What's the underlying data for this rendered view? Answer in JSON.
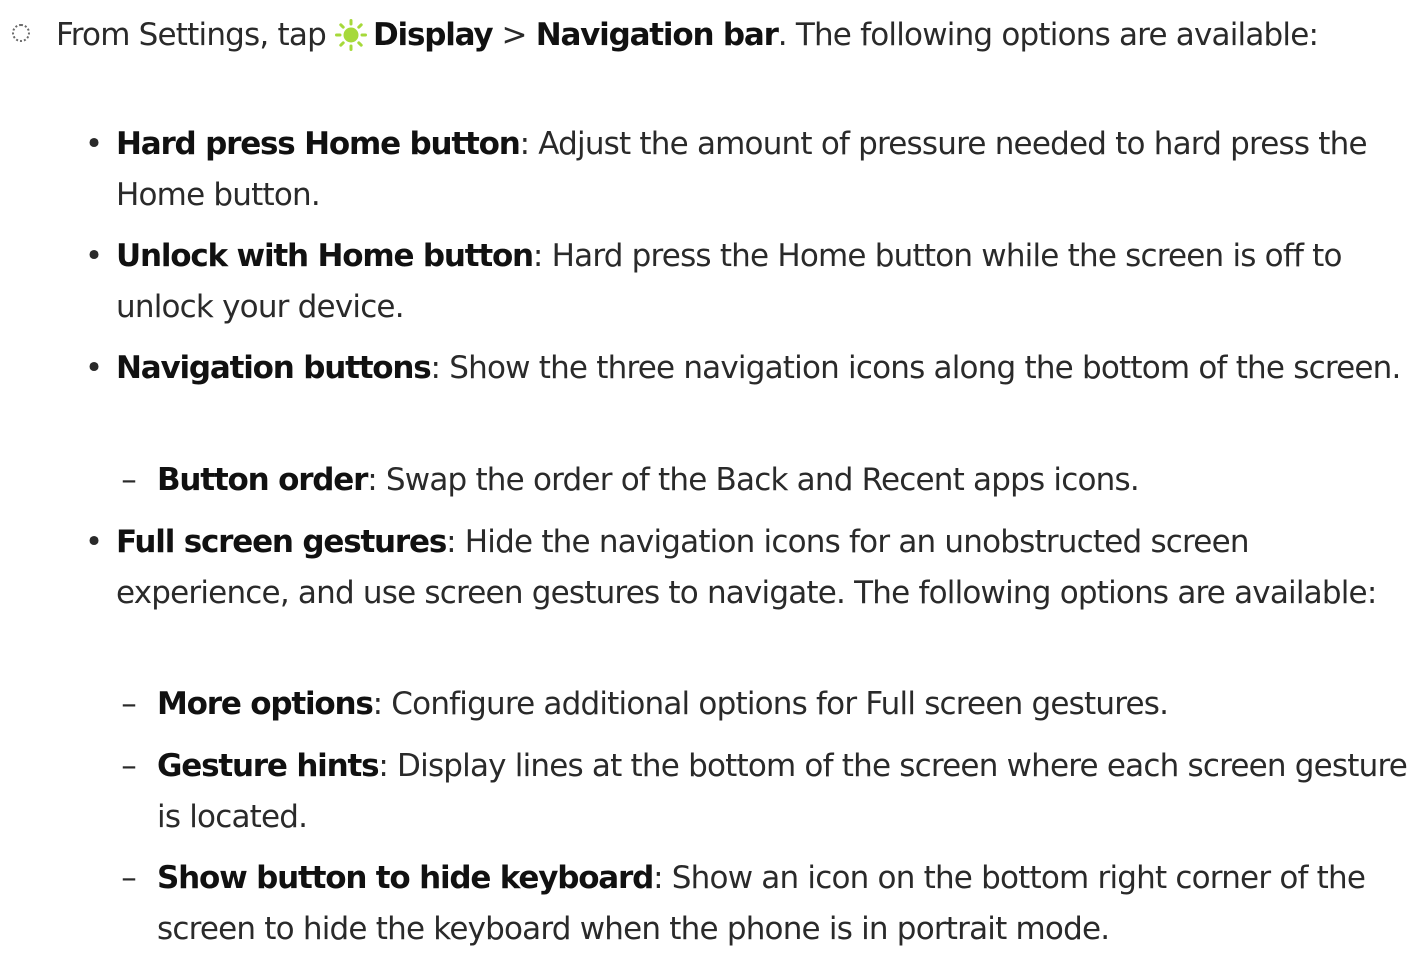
{
  "step": {
    "prefix": "From Settings, tap ",
    "icon": "display-brightness-icon",
    "icon_color": "#a6d93a",
    "path_1": "Display",
    "separator": " > ",
    "path_2": "Navigation bar",
    "suffix": ". The following options are available:"
  },
  "items": [
    {
      "marker": "•",
      "term": "Hard press Home button",
      "desc": ": Adjust the amount of pressure needed to hard press the Home button."
    },
    {
      "marker": "•",
      "term": "Unlock with Home button",
      "desc": ": Hard press the Home button while the screen is off to unlock your device."
    },
    {
      "marker": "•",
      "term": "Navigation buttons",
      "desc": ": Show the three navigation icons along the bottom of the screen."
    },
    {
      "marker": "–",
      "term": "Button order",
      "desc": ": Swap the order of the Back and Recent apps icons."
    },
    {
      "marker": "•",
      "term": "Full screen gestures",
      "desc": ": Hide the navigation icons for an unobstructed screen experience, and use screen gestures to navigate. The following options are available:"
    },
    {
      "marker": "–",
      "term": "More options",
      "desc": ": Configure additional options for Full screen gestures."
    },
    {
      "marker": "–",
      "term": "Gesture hints",
      "desc": ": Display lines at the bottom of the screen where each screen gesture is located."
    },
    {
      "marker": "–",
      "term": "Show button to hide keyboard",
      "desc": ": Show an icon on the bottom right corner of the screen to hide the keyboard when the phone is in portrait mode."
    }
  ]
}
